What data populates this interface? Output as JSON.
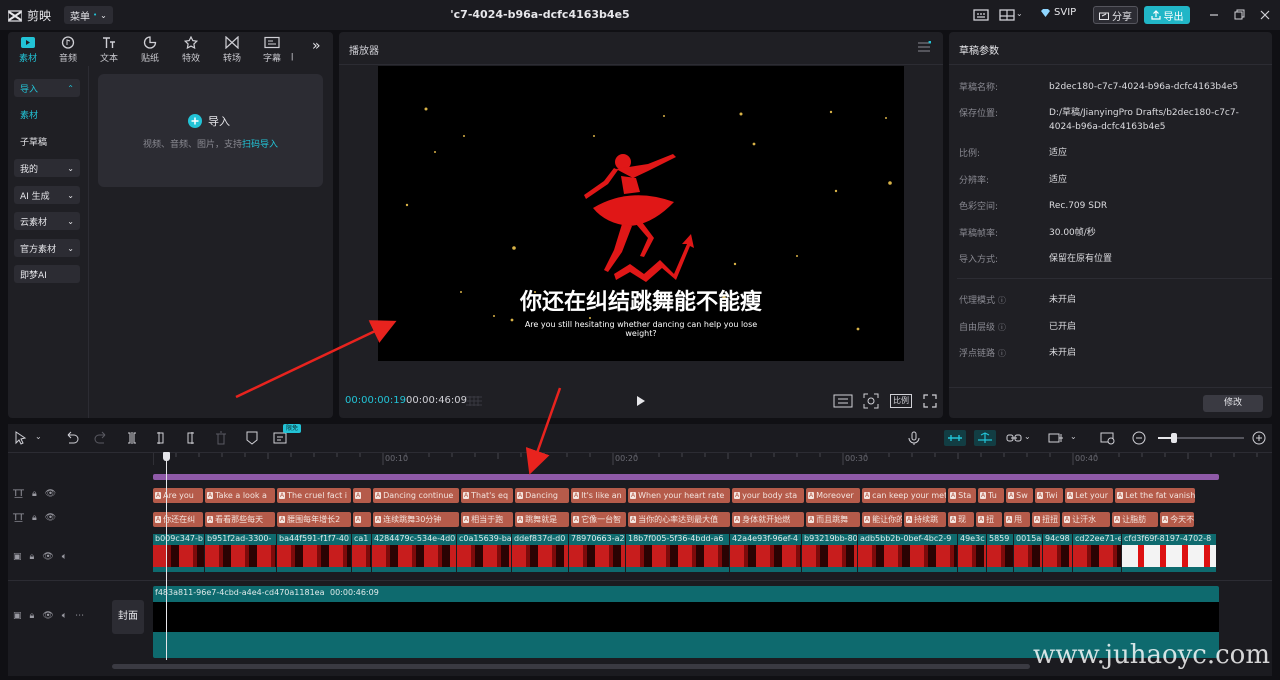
{
  "topbar": {
    "app_name": "剪映",
    "menu_label": "菜单",
    "doc_title": "'c7-4024-b96a-dcfc4163b4e5",
    "svip_label": "SVIP",
    "share_label": "分享",
    "export_label": "导出"
  },
  "left_panel": {
    "tabs": [
      {
        "label": "素材",
        "icon": "media-icon"
      },
      {
        "label": "音频",
        "icon": "audio-icon"
      },
      {
        "label": "文本",
        "icon": "text-icon"
      },
      {
        "label": "贴纸",
        "icon": "sticker-icon"
      },
      {
        "label": "特效",
        "icon": "effects-icon"
      },
      {
        "label": "转场",
        "icon": "transition-icon"
      },
      {
        "label": "字幕",
        "icon": "caption-icon"
      }
    ],
    "sidebar": {
      "import": "导入",
      "media": "素材",
      "sub_draft": "子草稿",
      "mine": "我的",
      "ai_gen": "AI 生成",
      "cloud": "云素材",
      "official": "官方素材",
      "jimeng": "即梦AI"
    },
    "import_box": {
      "button": "导入",
      "hint": "视频、音频、图片，支持",
      "hint_link": "扫码导入"
    }
  },
  "player": {
    "title": "播放器",
    "caption_cn": "你还在纠结跳舞能不能瘦",
    "caption_en_1": "Are you still hesitating whether dancing can help you lose",
    "caption_en_2": "weight?",
    "current_time": "00:00:00:19",
    "total_time": "00:00:46:09",
    "ratio_label": "比例"
  },
  "params": {
    "title": "草稿参数",
    "rows": [
      {
        "key": "草稿名称:",
        "value": "b2dec180-c7c7-4024-b96a-dcfc4163b4e5"
      },
      {
        "key": "保存位置:",
        "value": "D:/草稿/JianyingPro Drafts/b2dec180-c7c7-4024-b96a-dcfc4163b4e5"
      },
      {
        "key": "比例:",
        "value": "适应"
      },
      {
        "key": "分辨率:",
        "value": "适应"
      },
      {
        "key": "色彩空间:",
        "value": "Rec.709 SDR"
      },
      {
        "key": "草稿帧率:",
        "value": "30.00帧/秒"
      },
      {
        "key": "导入方式:",
        "value": "保留在原有位置"
      },
      {
        "key": "代理模式",
        "value": "未开启"
      },
      {
        "key": "自由层级",
        "value": "已开启"
      },
      {
        "key": "浮点链路",
        "value": "未开启"
      }
    ],
    "modify_label": "修改"
  },
  "timeline": {
    "badge": "限免",
    "ruler": [
      "00:10",
      "00:20",
      "00:30",
      "00:40"
    ],
    "text_track_1": [
      "Are you",
      "Take a look a",
      "The cruel fact i",
      "",
      "Dancing continue",
      "That's eq",
      "Dancing",
      "It's like an",
      "When your heart rate",
      "your body sta",
      "Moreover",
      "can keep your meta",
      "Sta",
      "Tu",
      "Sw",
      "Twi",
      "Let your",
      "Let the fat vanish in"
    ],
    "text_track_2": [
      "你还在纠",
      "看看那些每天",
      "腰围每年增长2",
      "",
      "连续跳舞30分钟",
      "相当于跑",
      "跳舞就是",
      "它像一台智",
      "当你的心率达到最大值",
      "身体就开始燃",
      "而且跳舞",
      "能让你的",
      "持续跳",
      "现",
      "扭",
      "甩",
      "扭扭",
      "让汗水",
      "让脂肪",
      "今天不"
    ],
    "video_clips": [
      "b009c347-b",
      "b951f2ad-3300-",
      "ba44f591-f1f7-40",
      "ca1",
      "4284479c-534e-4d0",
      "c0a15639-ba",
      "ddef837d-d0",
      "78970663-a2",
      "18b7f005-5f36-4bdd-a6",
      "42a4e93f-96ef-4",
      "b93219bb-80",
      "adb5bb2b-0bef-4bc2-9",
      "49e3c",
      "5859",
      "0015a",
      "94c98",
      "cd22ee71-e",
      "cfd3f69f-8197-4702-8"
    ],
    "main_track_name": "f483a811-96e7-4cbd-a4e4-cd470a1181ea",
    "main_track_duration": "00:00:46:09",
    "cover_label": "封面"
  },
  "watermark": "www.juhaoyc.com"
}
